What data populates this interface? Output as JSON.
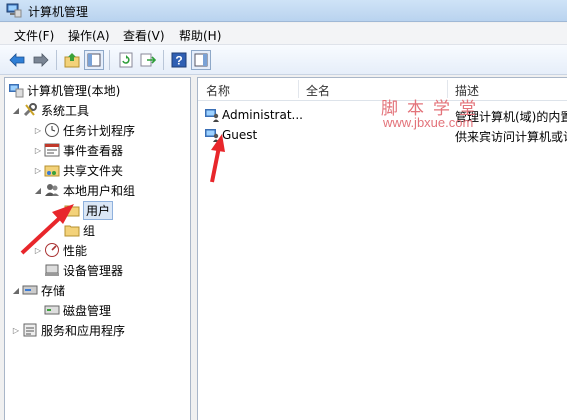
{
  "window": {
    "title": "计算机管理"
  },
  "menu": [
    "文件(F)",
    "操作(A)",
    "查看(V)",
    "帮助(H)"
  ],
  "toolbar": {
    "icons": [
      "back-arrow-icon",
      "forward-arrow-icon",
      "folder-up-icon",
      "show-hide-tree-icon",
      "refresh-icon",
      "export-list-icon",
      "help-icon",
      "action-pane-icon"
    ]
  },
  "tree": {
    "root": "计算机管理(本地)",
    "system_tools": "系统工具",
    "task_scheduler": "任务计划程序",
    "event_viewer": "事件查看器",
    "shared_folders": "共享文件夹",
    "local_users_groups": "本地用户和组",
    "users": "用户",
    "groups": "组",
    "performance": "性能",
    "device_manager": "设备管理器",
    "storage": "存储",
    "disk_management": "磁盘管理",
    "services_apps": "服务和应用程序"
  },
  "list": {
    "columns": [
      "名称",
      "全名",
      "描述"
    ],
    "rows": [
      {
        "name": "Administrat...",
        "fullname": "",
        "description": "管理计算机(域)的内置"
      },
      {
        "name": "Guest",
        "fullname": "",
        "description": "供来宾访问计算机或访"
      }
    ]
  },
  "watermark": {
    "line1": "脚本学堂",
    "line2": "www.jbxue.com",
    "color": "#e3737a"
  },
  "colors": {
    "annotation_arrow": "#e8262b",
    "selection": "#dbe7f6"
  }
}
